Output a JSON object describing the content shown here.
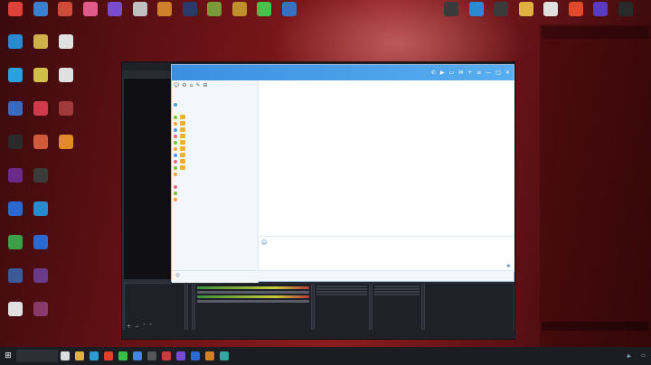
{
  "desktop": {
    "top_icons": [
      {
        "label": "",
        "color": "#e0403a"
      },
      {
        "label": "",
        "color": "#3a7fd0"
      },
      {
        "label": "",
        "color": "#d04a3a"
      },
      {
        "label": "",
        "color": "#e05a8a"
      },
      {
        "label": "",
        "color": "#7a4ad0"
      },
      {
        "label": "",
        "color": "#c0c0c0"
      },
      {
        "label": "",
        "color": "#d0802a"
      },
      {
        "label": "",
        "color": "#2a3a6a"
      },
      {
        "label": "",
        "color": "#7a9a3a"
      },
      {
        "label": "",
        "color": "#c0902a"
      },
      {
        "label": "",
        "color": "#4ac04a"
      },
      {
        "label": "",
        "color": "#3a70c0"
      }
    ],
    "left_icons": [
      {
        "label": "",
        "color": "#2a8ad0"
      },
      {
        "label": "",
        "color": "#d0b04a"
      },
      {
        "label": "",
        "color": "#e0e0e0"
      },
      {
        "label": "",
        "color": "#2aa0e0"
      },
      {
        "label": "",
        "color": "#d0c04a"
      },
      {
        "label": "",
        "color": "#e0e0e0"
      },
      {
        "label": "",
        "color": "#3a6ac0"
      },
      {
        "label": "",
        "color": "#d03a4a"
      },
      {
        "label": "",
        "color": "#a03a3a"
      },
      {
        "label": "",
        "color": "#2a2a2a"
      },
      {
        "label": "",
        "color": "#d05a3a"
      },
      {
        "label": "",
        "color": "#e08a2a"
      },
      {
        "label": "",
        "color": "#6a2a8a"
      },
      {
        "label": "",
        "color": "#3a3a3a"
      },
      {
        "label": "",
        "color": "#2a6ad0"
      },
      {
        "label": "",
        "color": "#2a8ad0"
      },
      {
        "label": "",
        "color": "#3aa04a"
      },
      {
        "label": "",
        "color": "#2a6ad0"
      },
      {
        "label": "",
        "color": "#3a5a9a"
      },
      {
        "label": "",
        "color": "#6a3a8a"
      },
      {
        "label": "",
        "color": "#e0e0e0"
      },
      {
        "label": "",
        "color": "#8a3a6a"
      }
    ],
    "right_icons": [
      {
        "label": "",
        "color": "#3a3a3a"
      },
      {
        "label": "",
        "color": "#2a8ad0"
      },
      {
        "label": "",
        "color": "#3a3a3a"
      },
      {
        "label": "",
        "color": "#e0b040"
      },
      {
        "label": "",
        "color": "#e0e0e0"
      },
      {
        "label": "",
        "color": "#e04a2a"
      },
      {
        "label": "",
        "color": "#5a3ac0"
      },
      {
        "label": "",
        "color": "#2a2a2a"
      }
    ]
  },
  "obs": {
    "title": "",
    "menu": [
      "",
      "",
      "",
      "",
      "",
      "",
      ""
    ],
    "docks": {
      "scenes_title": "",
      "scene_item": "",
      "sources_title": "",
      "mixer_tracks": [
        "",
        ""
      ],
      "transition_buttons": [
        "",
        "",
        "",
        ""
      ],
      "controls": [
        "",
        "",
        "",
        ""
      ],
      "right_label": "",
      "right_value": ""
    },
    "status": [
      "",
      "",
      "",
      "",
      ""
    ]
  },
  "chat": {
    "title": "",
    "left_panel": {
      "tools": [
        "☺",
        "⚙",
        "⌂",
        "✎",
        "⊞"
      ],
      "header_left": "",
      "header_right": "",
      "rows": [
        {
          "text": "",
          "cls": "group"
        },
        {
          "text": "",
          "cls": ""
        },
        {
          "text": "",
          "cls": "group blue"
        },
        {
          "text": "",
          "cls": "",
          "badge": true
        },
        {
          "text": "",
          "cls": "",
          "badge": true
        },
        {
          "text": "",
          "cls": "",
          "badge": true
        },
        {
          "text": "",
          "cls": "",
          "badge": true
        },
        {
          "text": "",
          "cls": "",
          "badge": true
        },
        {
          "text": "",
          "cls": "",
          "badge": true
        },
        {
          "text": "",
          "cls": "",
          "badge": true
        },
        {
          "text": "",
          "cls": "",
          "badge": true
        },
        {
          "text": "",
          "cls": "",
          "badge": true
        },
        {
          "text": "",
          "cls": ""
        },
        {
          "text": "",
          "cls": "red"
        },
        {
          "text": "",
          "cls": ""
        },
        {
          "text": "",
          "cls": ""
        },
        {
          "text": "",
          "cls": ""
        },
        {
          "text": "",
          "cls": "group"
        }
      ]
    },
    "messages": [
      {
        "tag": "",
        "text": ""
      },
      {
        "tag": "",
        "text": ""
      },
      {
        "tag": "",
        "text": ""
      },
      {
        "tag": "",
        "text": ""
      }
    ],
    "bottom": [
      "",
      "",
      "",
      ""
    ],
    "bottom_right": ""
  },
  "danmaku": {
    "stats": [
      "",
      "",
      ""
    ],
    "lines": [
      {
        "user": "",
        "text": ""
      },
      {
        "user": "",
        "text": ""
      },
      {
        "user": "",
        "text": ""
      },
      {
        "user": "",
        "text": ""
      },
      {
        "user": "",
        "text": ""
      },
      {
        "user": "",
        "text": ""
      },
      {
        "user": "",
        "text": ""
      },
      {
        "user": "",
        "text": ""
      },
      {
        "user": "",
        "text": ""
      },
      {
        "user": "",
        "text": ""
      },
      {
        "user": "",
        "text": ""
      },
      {
        "user": "",
        "text": ""
      },
      {
        "user": "",
        "text": ""
      },
      {
        "user": "",
        "text": ""
      },
      {
        "user": "",
        "text": ""
      },
      {
        "user": "",
        "text": ""
      },
      {
        "user": "",
        "text": ""
      },
      {
        "user": "",
        "text": ""
      },
      {
        "user": "",
        "text": ""
      },
      {
        "user": "",
        "text": ""
      },
      {
        "user": "",
        "text": ""
      },
      {
        "user": "",
        "text": ""
      },
      {
        "user": "",
        "text": ""
      },
      {
        "user": "",
        "text": ""
      },
      {
        "user": "",
        "text": ""
      },
      {
        "user": "",
        "text": ""
      },
      {
        "user": "",
        "text": ""
      },
      {
        "user": "",
        "text": ""
      },
      {
        "user": "",
        "text": ""
      },
      {
        "user": "",
        "text": ""
      },
      {
        "user": "",
        "text": ""
      },
      {
        "user": "",
        "text": ""
      },
      {
        "user": "",
        "text": ""
      },
      {
        "user": "",
        "text": ""
      },
      {
        "user": "",
        "text": ""
      },
      {
        "user": "",
        "text": ""
      },
      {
        "user": "",
        "text": ""
      },
      {
        "user": "",
        "text": ""
      },
      {
        "user": "",
        "text": ""
      },
      {
        "user": "",
        "text": ""
      },
      {
        "user": "",
        "text": ""
      },
      {
        "user": "",
        "text": ""
      }
    ],
    "input_placeholder": ""
  },
  "taskbar": {
    "start_icon": "windows-logo-icon",
    "search_placeholder": "",
    "apps": [
      {
        "name": "task-view-icon",
        "color": "#dddddd"
      },
      {
        "name": "file-explorer-icon",
        "color": "#e0b040"
      },
      {
        "name": "edge-icon",
        "color": "#2a9ad0"
      },
      {
        "name": "chrome-icon",
        "color": "#e0402a"
      },
      {
        "name": "wechat-icon",
        "color": "#3ac04a"
      },
      {
        "name": "qq-icon",
        "color": "#3a8ae0"
      },
      {
        "name": "obs-icon",
        "color": "#555555"
      },
      {
        "name": "music-icon",
        "color": "#d03a3a"
      },
      {
        "name": "game-icon",
        "color": "#7a4ad0"
      },
      {
        "name": "app-icon",
        "color": "#2a6ad0"
      },
      {
        "name": "app-icon-2",
        "color": "#d0802a"
      },
      {
        "name": "app-icon-3",
        "color": "#3aa0a0"
      }
    ],
    "tray_text": "",
    "time": "",
    "date": ""
  }
}
